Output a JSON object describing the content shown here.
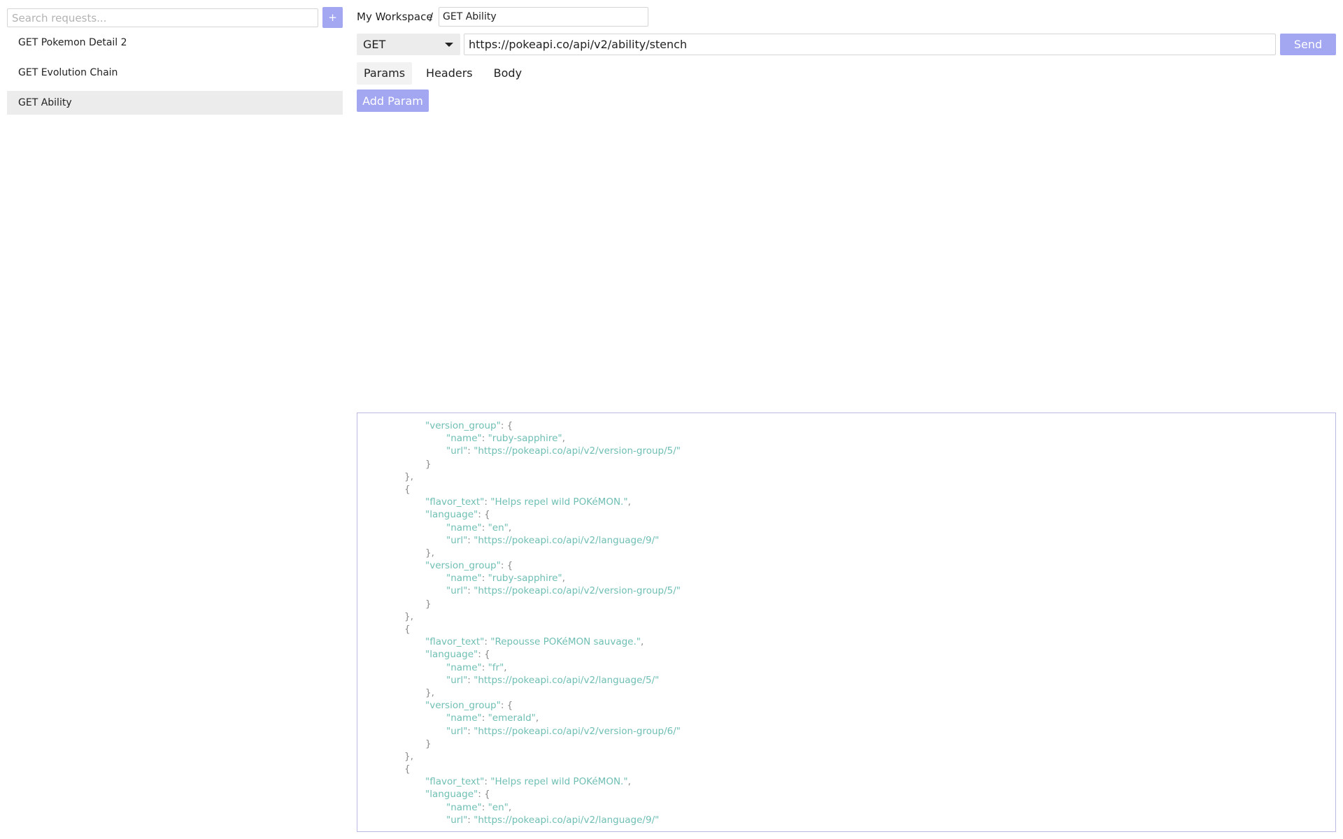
{
  "sidebar": {
    "search_placeholder": "Search requests...",
    "add_label": "+",
    "items": [
      {
        "label": "GET Pokemon Detail 2",
        "active": false
      },
      {
        "label": "GET Evolution Chain",
        "active": false
      },
      {
        "label": "GET Ability",
        "active": true
      }
    ]
  },
  "header": {
    "workspace": "My Workspace",
    "separator": "/",
    "request_name": "GET Ability"
  },
  "request": {
    "method": "GET",
    "url": "https://pokeapi.co/api/v2/ability/stench",
    "send_label": "Send"
  },
  "tabs": [
    {
      "label": "Params",
      "active": true
    },
    {
      "label": "Headers",
      "active": false
    },
    {
      "label": "Body",
      "active": false
    }
  ],
  "params": {
    "add_param_label": "Add Param"
  },
  "response": {
    "lines": [
      {
        "indent": 2,
        "key": "\"version_group\"",
        "sep": ": {",
        "value": "",
        "trail": ""
      },
      {
        "indent": 3,
        "key": "\"name\"",
        "sep": ": ",
        "value": "\"ruby-sapphire\"",
        "trail": ","
      },
      {
        "indent": 3,
        "key": "\"url\"",
        "sep": ": ",
        "value": "\"https://pokeapi.co/api/v2/version-group/5/\"",
        "trail": ""
      },
      {
        "indent": 2,
        "key": "",
        "sep": "}",
        "value": "",
        "trail": ""
      },
      {
        "indent": 1,
        "key": "",
        "sep": "},",
        "value": "",
        "trail": ""
      },
      {
        "indent": 1,
        "key": "",
        "sep": "{",
        "value": "",
        "trail": ""
      },
      {
        "indent": 2,
        "key": "\"flavor_text\"",
        "sep": ": ",
        "value": "\"Helps repel wild POKéMON.\"",
        "trail": ","
      },
      {
        "indent": 2,
        "key": "\"language\"",
        "sep": ": {",
        "value": "",
        "trail": ""
      },
      {
        "indent": 3,
        "key": "\"name\"",
        "sep": ": ",
        "value": "\"en\"",
        "trail": ","
      },
      {
        "indent": 3,
        "key": "\"url\"",
        "sep": ": ",
        "value": "\"https://pokeapi.co/api/v2/language/9/\"",
        "trail": ""
      },
      {
        "indent": 2,
        "key": "",
        "sep": "},",
        "value": "",
        "trail": ""
      },
      {
        "indent": 2,
        "key": "\"version_group\"",
        "sep": ": {",
        "value": "",
        "trail": ""
      },
      {
        "indent": 3,
        "key": "\"name\"",
        "sep": ": ",
        "value": "\"ruby-sapphire\"",
        "trail": ","
      },
      {
        "indent": 3,
        "key": "\"url\"",
        "sep": ": ",
        "value": "\"https://pokeapi.co/api/v2/version-group/5/\"",
        "trail": ""
      },
      {
        "indent": 2,
        "key": "",
        "sep": "}",
        "value": "",
        "trail": ""
      },
      {
        "indent": 1,
        "key": "",
        "sep": "},",
        "value": "",
        "trail": ""
      },
      {
        "indent": 1,
        "key": "",
        "sep": "{",
        "value": "",
        "trail": ""
      },
      {
        "indent": 2,
        "key": "\"flavor_text\"",
        "sep": ": ",
        "value": "\"Repousse POKéMON sauvage.\"",
        "trail": ","
      },
      {
        "indent": 2,
        "key": "\"language\"",
        "sep": ": {",
        "value": "",
        "trail": ""
      },
      {
        "indent": 3,
        "key": "\"name\"",
        "sep": ": ",
        "value": "\"fr\"",
        "trail": ","
      },
      {
        "indent": 3,
        "key": "\"url\"",
        "sep": ": ",
        "value": "\"https://pokeapi.co/api/v2/language/5/\"",
        "trail": ""
      },
      {
        "indent": 2,
        "key": "",
        "sep": "},",
        "value": "",
        "trail": ""
      },
      {
        "indent": 2,
        "key": "\"version_group\"",
        "sep": ": {",
        "value": "",
        "trail": ""
      },
      {
        "indent": 3,
        "key": "\"name\"",
        "sep": ": ",
        "value": "\"emerald\"",
        "trail": ","
      },
      {
        "indent": 3,
        "key": "\"url\"",
        "sep": ": ",
        "value": "\"https://pokeapi.co/api/v2/version-group/6/\"",
        "trail": ""
      },
      {
        "indent": 2,
        "key": "",
        "sep": "}",
        "value": "",
        "trail": ""
      },
      {
        "indent": 1,
        "key": "",
        "sep": "},",
        "value": "",
        "trail": ""
      },
      {
        "indent": 1,
        "key": "",
        "sep": "{",
        "value": "",
        "trail": ""
      },
      {
        "indent": 2,
        "key": "\"flavor_text\"",
        "sep": ": ",
        "value": "\"Helps repel wild POKéMON.\"",
        "trail": ","
      },
      {
        "indent": 2,
        "key": "\"language\"",
        "sep": ": {",
        "value": "",
        "trail": ""
      },
      {
        "indent": 3,
        "key": "\"name\"",
        "sep": ": ",
        "value": "\"en\"",
        "trail": ","
      },
      {
        "indent": 3,
        "key": "\"url\"",
        "sep": ": ",
        "value": "\"https://pokeapi.co/api/v2/language/9/\"",
        "trail": ""
      }
    ]
  },
  "colors": {
    "accent": "#a3a7f2",
    "json_token": "#6fbfb4",
    "json_punctuation": "#8a8a8a"
  }
}
